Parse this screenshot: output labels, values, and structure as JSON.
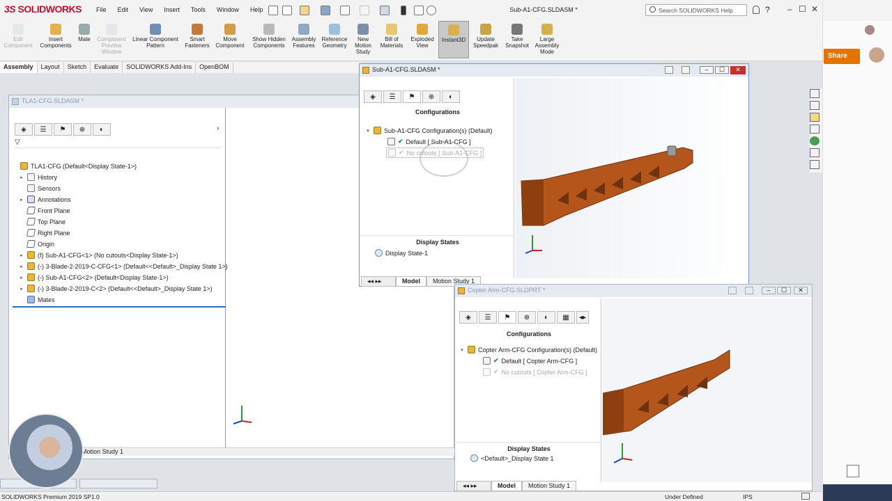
{
  "app": {
    "logo_prefix": "3S",
    "logo_text": "SOLIDWORKS",
    "menus": [
      "File",
      "Edit",
      "View",
      "Insert",
      "Tools",
      "Window",
      "Help"
    ],
    "doc_title": "Sub-A1-CFG.SLDASM *",
    "search_placeholder": "Search SOLIDWORKS Help",
    "win_controls": [
      "–",
      "☐",
      "✕"
    ]
  },
  "ribbon": {
    "edit_component": "Edit Component",
    "insert_components": "Insert Components",
    "mate": "Mate",
    "component_preview": "Component Preview Window",
    "linear_pattern": "Linear Component Pattern",
    "smart_fasteners": "Smart Fasteners",
    "move_component": "Move Component",
    "show_hidden": "Show Hidden Components",
    "assembly_features": "Assembly Features",
    "reference_geometry": "Reference Geometry",
    "new_motion_study": "New Motion Study",
    "bill_of_materials": "Bill of Materials",
    "exploded_view": "Exploded View",
    "instant3d": "Instant3D",
    "update_speedpak": "Update Speedpak",
    "take_snapshot": "Take Snapshot",
    "large_assembly_mode": "Large Assembly Mode"
  },
  "cm_tabs": [
    "Assembly",
    "Layout",
    "Sketch",
    "Evaluate",
    "SOLIDWORKS Add-Ins",
    "OpenBOM"
  ],
  "tla_window": {
    "title": "TLA1-CFG.SLDASM *",
    "tree": [
      {
        "label": "TLA1-CFG  (Default<Display State-1>)",
        "icon": "assembly-icon",
        "indent": 0,
        "exp": ""
      },
      {
        "label": "History",
        "icon": "history-icon",
        "indent": 1,
        "exp": "▸"
      },
      {
        "label": "Sensors",
        "icon": "sensors-icon",
        "indent": 1,
        "exp": ""
      },
      {
        "label": "Annotations",
        "icon": "annotations-icon",
        "indent": 1,
        "exp": "▸"
      },
      {
        "label": "Front Plane",
        "icon": "plane-icon",
        "indent": 1,
        "exp": ""
      },
      {
        "label": "Top Plane",
        "icon": "plane-icon",
        "indent": 1,
        "exp": ""
      },
      {
        "label": "Right Plane",
        "icon": "plane-icon",
        "indent": 1,
        "exp": ""
      },
      {
        "label": "Origin",
        "icon": "origin-icon",
        "indent": 1,
        "exp": ""
      },
      {
        "label": "(f) Sub-A1-CFG<1> (No cutouts<Display State-1>)",
        "icon": "subassembly-icon",
        "indent": 1,
        "exp": "▸"
      },
      {
        "label": "(-) 3-Blade-2-2019-C-CFG<1> (Default<<Default>_Display State 1>)",
        "icon": "subassembly-icon",
        "indent": 1,
        "exp": "▸"
      },
      {
        "label": "(-) Sub-A1-CFG<2> (Default<Display State-1>)",
        "icon": "subassembly-icon",
        "indent": 1,
        "exp": "▸"
      },
      {
        "label": "(-) 3-Blade-2-2019-C<2> (Default<<Default>_Display State 1>)",
        "icon": "subassembly-icon",
        "indent": 1,
        "exp": "▸"
      },
      {
        "label": "Mates",
        "icon": "mates-icon",
        "indent": 1,
        "exp": ""
      }
    ],
    "motion_tab": "Motion Study 1"
  },
  "sub_window": {
    "title": "Sub-A1-CFG.SLDASM *",
    "configurations_header": "Configurations",
    "config_root": "Sub-A1-CFG Configuration(s)  (Default)",
    "config_default": "Default [ Sub-A1-CFG ]",
    "config_nocutouts": "No cutouts [ Sub-A1-CFG ]",
    "display_states_header": "Display States",
    "display_state": "Display State-1",
    "tabs": [
      "Model",
      "Motion Study 1"
    ]
  },
  "arm_window": {
    "title": "Copter Arm-CFG.SLDPRT *",
    "configurations_header": "Configurations",
    "config_root": "Copter Arm-CFG Configuration(s)  (Default)",
    "config_default": "Default [ Copter Arm-CFG ]",
    "config_nocutouts": "No cutouts [ Copter Arm-CFG ]",
    "display_states_header": "Display States",
    "display_state": "<Default>_Display State 1",
    "tabs": [
      "Model",
      "Motion Study 1"
    ]
  },
  "status": {
    "version": "SOLIDWORKS Premium 2019 SP1.0",
    "state": "Under Defined",
    "units": "IPS"
  },
  "share_label": "Share",
  "colors": {
    "accent": "#e67300",
    "part": "#b4561c",
    "brand": "#c8102e"
  }
}
